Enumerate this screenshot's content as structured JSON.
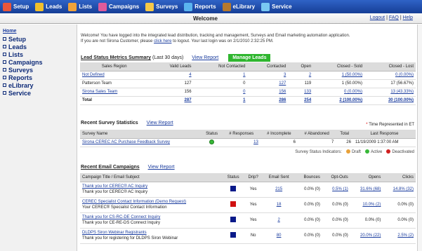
{
  "nav": [
    {
      "label": "Setup",
      "icon": "setup-icon",
      "color": "#e8563a"
    },
    {
      "label": "Leads",
      "icon": "leads-icon",
      "color": "#f2c02c"
    },
    {
      "label": "Lists",
      "icon": "lists-icon",
      "color": "#f0a33a"
    },
    {
      "label": "Campaigns",
      "icon": "campaigns-icon",
      "color": "#e05b9b"
    },
    {
      "label": "Surveys",
      "icon": "surveys-icon",
      "color": "#f7c948"
    },
    {
      "label": "Reports",
      "icon": "reports-icon",
      "color": "#5ab4ef"
    },
    {
      "label": "eLibrary",
      "icon": "elibrary-icon",
      "color": "#b5792d"
    },
    {
      "label": "Service",
      "icon": "service-icon",
      "color": "#79c8f2"
    }
  ],
  "header": {
    "title": "Welcome",
    "logout": "Logout",
    "faq": "FAQ",
    "help": "Help"
  },
  "sidebar": {
    "home": "Home",
    "items": [
      "Setup",
      "Leads",
      "Lists",
      "Campaigns",
      "Surveys",
      "Reports",
      "eLibrary",
      "Service"
    ]
  },
  "welcome": {
    "line1": "Welcome! You have logged into the integrated lead distribution, tracking and management, Surveys and Email marketing automation application.",
    "line2_pre": "If you are not Sirona Customer, please",
    "line2_link": "click here",
    "line2_post": "to logout. Your last login was on 2/1/2010 2:32:25 PM."
  },
  "lead_status": {
    "heading": "Lead Status Metrics Summary",
    "period": "(Last 30 days)",
    "view_report": "View Report",
    "manage": "Manage Leads",
    "columns": [
      "Sales Region",
      "Valid Leads",
      "Not Contacted",
      "Contacted",
      "Open",
      "Closed - Sold",
      "Closed - Lost"
    ],
    "rows": [
      [
        "Not Defined",
        "4",
        "1",
        "3",
        "2",
        "1 (50.00%)",
        "0 (0.00%)"
      ],
      [
        "Patterson Team",
        "127",
        "0",
        "127",
        "119",
        "1 (50.00%)",
        "17 (56.67%)"
      ],
      [
        "Sirona Sales Team",
        "156",
        "0",
        "156",
        "133",
        "0 (0.00%)",
        "13 (43.33%)"
      ]
    ],
    "total": [
      "Total",
      "287",
      "1",
      "286",
      "254",
      "2 (100.00%)",
      "30 (100.00%)"
    ]
  },
  "survey": {
    "heading": "Recent Survey Statistics",
    "view_report": "View Report",
    "time_note": "Time Represented in ET",
    "columns": [
      "Survey Name",
      "Status",
      "# Responses",
      "# Incomplete",
      "# Abandoned",
      "Total",
      "Last Response"
    ],
    "rows": [
      [
        "Sirona CEREC AC Purchase Feedback Survey",
        "",
        "13",
        "6",
        "7",
        "26",
        "11/19/2009 1:37:00 AM"
      ]
    ],
    "legend_label": "Survey Status Indicators:",
    "legend": [
      {
        "label": "Draft",
        "color": "#e8a13a"
      },
      {
        "label": "Active",
        "color": "#38b838"
      },
      {
        "label": "Deactivated",
        "color": "#d02020"
      }
    ]
  },
  "email": {
    "heading": "Recent Email Campaigns",
    "view_report": "View Report",
    "columns": [
      "Campaign Title / Email Subject",
      "Status",
      "Drip?",
      "Email Sent",
      "Bounces",
      "Opt-Outs",
      "Opens",
      "Clicks"
    ],
    "rows": [
      {
        "title": "Thank you for CEREC® AC Inquiry",
        "subject": "Thank you for CEREC® AC Inquiry",
        "status_color": "#0a1a8a",
        "drip": "Yes",
        "sent": "215",
        "bounces": "0.0% (0)",
        "optouts": "0.5% (1)",
        "opens": "31.6% (68)",
        "clicks": "14.8% (32)"
      },
      {
        "title": "CEREC Specialist Contact Information (Demo Request)",
        "subject": "Your CEREC® Specialist Contact Information",
        "status_color": "#d01010",
        "drip": "Yes",
        "sent": "18",
        "bounces": "0.0% (0)",
        "optouts": "0.0% (0)",
        "opens": "10.0% (2)",
        "clicks": "0.0% (0)"
      },
      {
        "title": "Thank you for CS-RC-DE Connect Inquiry",
        "subject": "Thank you for CE-RE-DS Connect Inquiry",
        "status_color": "#0a1a8a",
        "drip": "Yes",
        "sent": "2",
        "bounces": "0.0% (0)",
        "optouts": "0.0% (0)",
        "opens": "0.0% (0)",
        "clicks": "0.0% (0)"
      },
      {
        "title": "DLDPS Siron Webinar Registrants",
        "subject": "Thank you for registering for DLDPS Siron Webinar",
        "status_color": "#0a1a8a",
        "drip": "No",
        "sent": "80",
        "bounces": "0.0% (0)",
        "optouts": "0.0% (0)",
        "opens": "20.0% (22)",
        "clicks": "2.5% (2)"
      }
    ]
  }
}
